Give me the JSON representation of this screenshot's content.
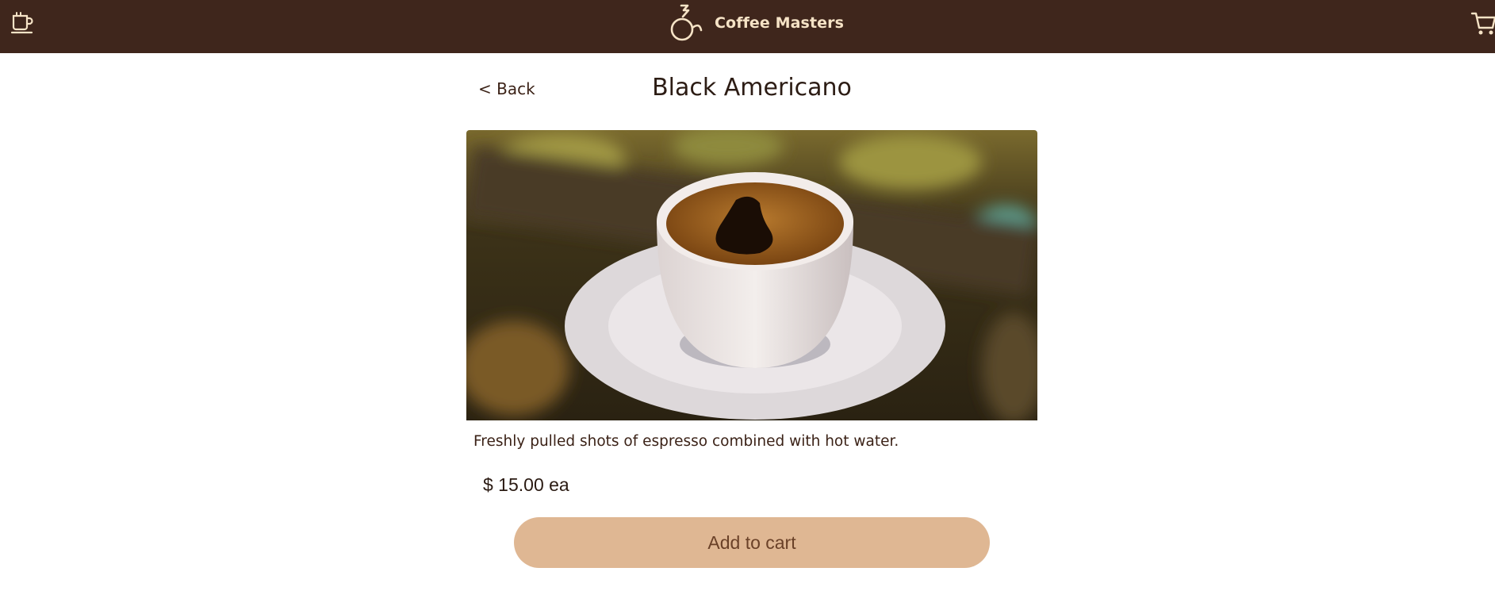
{
  "header": {
    "brand_title": "Coffee Masters",
    "menu_icon": "coffee-cup-icon",
    "logo_icon": "coffee-masters-logo-icon",
    "cart_icon": "shopping-cart-icon",
    "background_color": "#3f261c",
    "title_color": "#f6e3c6"
  },
  "product": {
    "back_label": "< Back",
    "title": "Black Americano",
    "image_alt": "black coffee in white cup on saucer",
    "description": "Freshly pulled shots of espresso combined with hot water.",
    "price_text": "$ 15.00 ea",
    "add_to_cart_label": "Add to cart",
    "button_color": "#dfb793"
  }
}
